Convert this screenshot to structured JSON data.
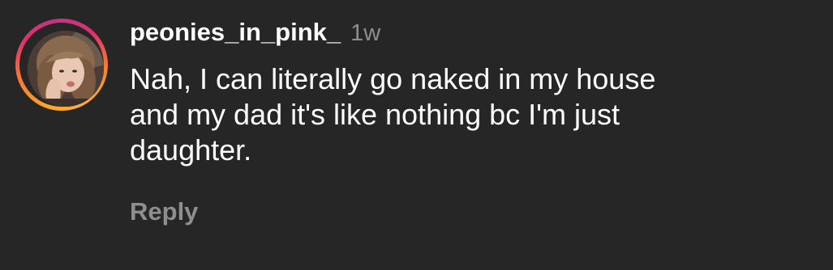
{
  "comment": {
    "username": "peonies_in_pink_",
    "timestamp": "1w",
    "text": "Nah, I can literally go naked in my house\nand my dad it's like nothing bc I'm just\ndaughter.",
    "reply_label": "Reply",
    "avatar_icon": "user-profile-photo",
    "story_ring_colors": [
      "#f9a825",
      "#f77737",
      "#e1306c",
      "#c13584"
    ]
  },
  "colors": {
    "background": "#262626",
    "primary_text": "#ffffff",
    "secondary_text": "#8e8e8e"
  }
}
